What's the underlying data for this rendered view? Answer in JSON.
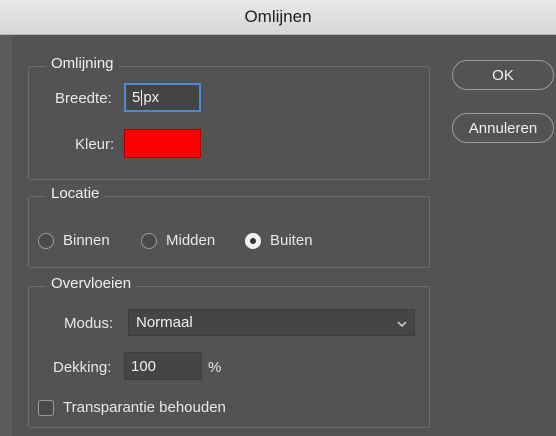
{
  "window": {
    "title": "Omlijnen"
  },
  "stroke": {
    "legend": "Omlijning",
    "width_label": "Breedte:",
    "width_value": "5",
    "width_unit": "px",
    "color_label": "Kleur:",
    "color": "#ff0000"
  },
  "location": {
    "legend": "Locatie",
    "options": [
      {
        "label": "Binnen",
        "selected": false
      },
      {
        "label": "Midden",
        "selected": false
      },
      {
        "label": "Buiten",
        "selected": true
      }
    ]
  },
  "blending": {
    "legend": "Overvloeien",
    "mode_label": "Modus:",
    "mode_value": "Normaal",
    "opacity_label": "Dekking:",
    "opacity_value": "100",
    "opacity_unit": "%",
    "preserve_label": "Transparantie behouden",
    "preserve_checked": false
  },
  "buttons": {
    "ok": "OK",
    "cancel": "Annuleren"
  }
}
